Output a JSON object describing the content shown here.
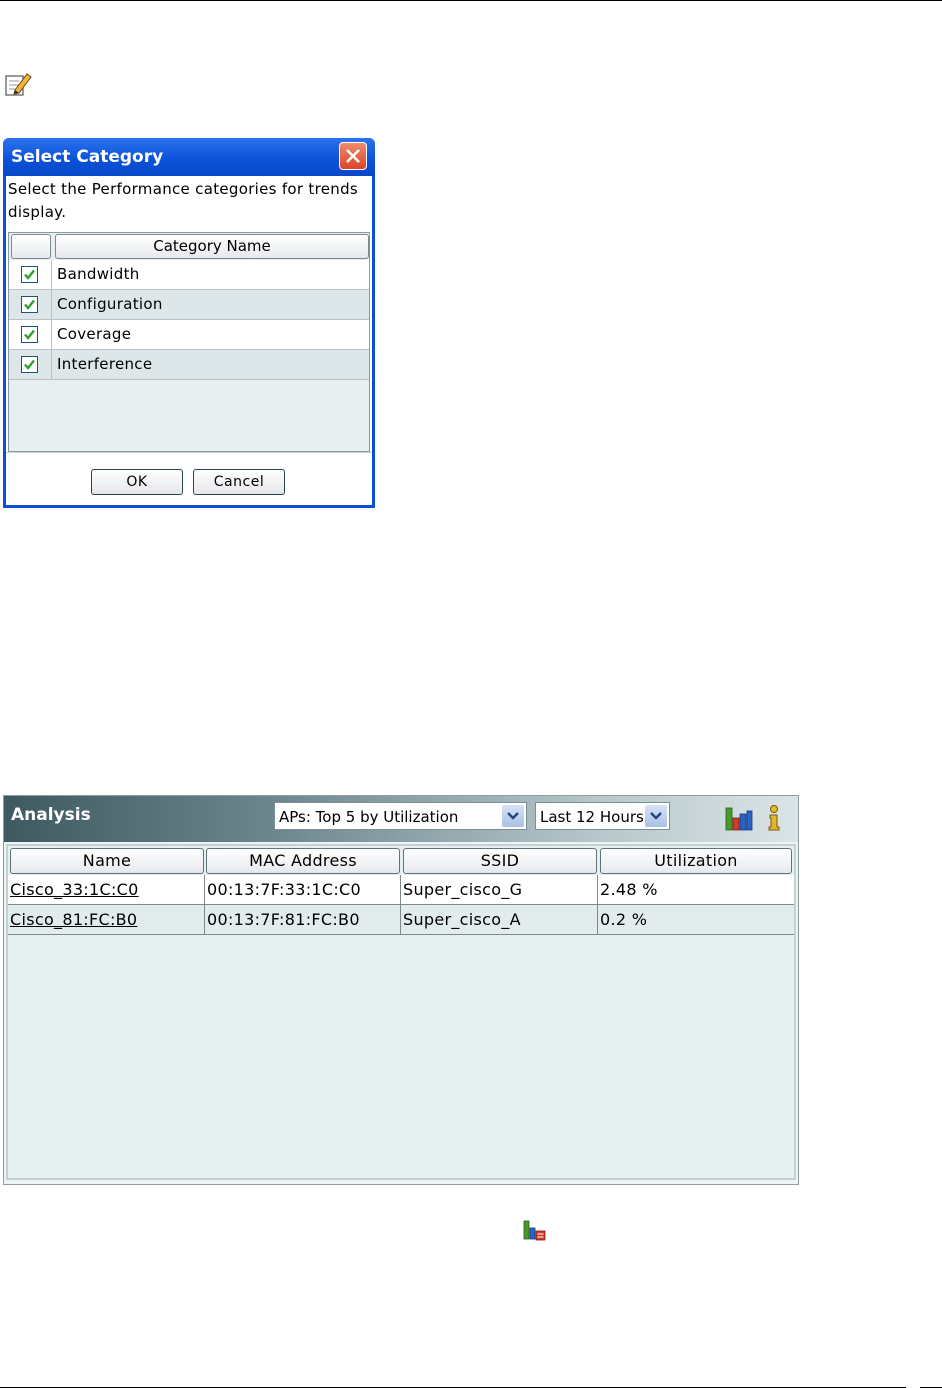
{
  "dialog": {
    "title": "Select Category",
    "description": "Select the Performance categories for trends display.",
    "column_header": "Category Name",
    "categories": [
      {
        "label": "Bandwidth",
        "checked": true
      },
      {
        "label": "Configuration",
        "checked": true
      },
      {
        "label": "Coverage",
        "checked": true
      },
      {
        "label": "Interference",
        "checked": true
      }
    ],
    "ok_label": "OK",
    "cancel_label": "Cancel"
  },
  "analysis": {
    "title": "Analysis",
    "filter_select": "APs: Top 5 by Utilization",
    "time_select": "Last 12 Hours",
    "columns": [
      "Name",
      "MAC Address",
      "SSID",
      "Utilization"
    ],
    "rows": [
      {
        "name": "Cisco_33:1C:C0",
        "mac": "00:13:7F:33:1C:C0",
        "ssid": "Super_cisco_G",
        "utilization": "2.48 %"
      },
      {
        "name": "Cisco_81:FC:B0",
        "mac": "00:13:7F:81:FC:B0",
        "ssid": "Super_cisco_A",
        "utilization": "0.2 %"
      }
    ]
  },
  "icons": {
    "note": "note-edit-icon",
    "chart": "bar-chart-icon",
    "info": "info-icon",
    "small_chart": "chart-settings-icon"
  },
  "colors": {
    "dialog_title": "#0a50d8",
    "close_button": "#d9452a",
    "analysis_header": "#3f5961",
    "check": "#29a329"
  }
}
